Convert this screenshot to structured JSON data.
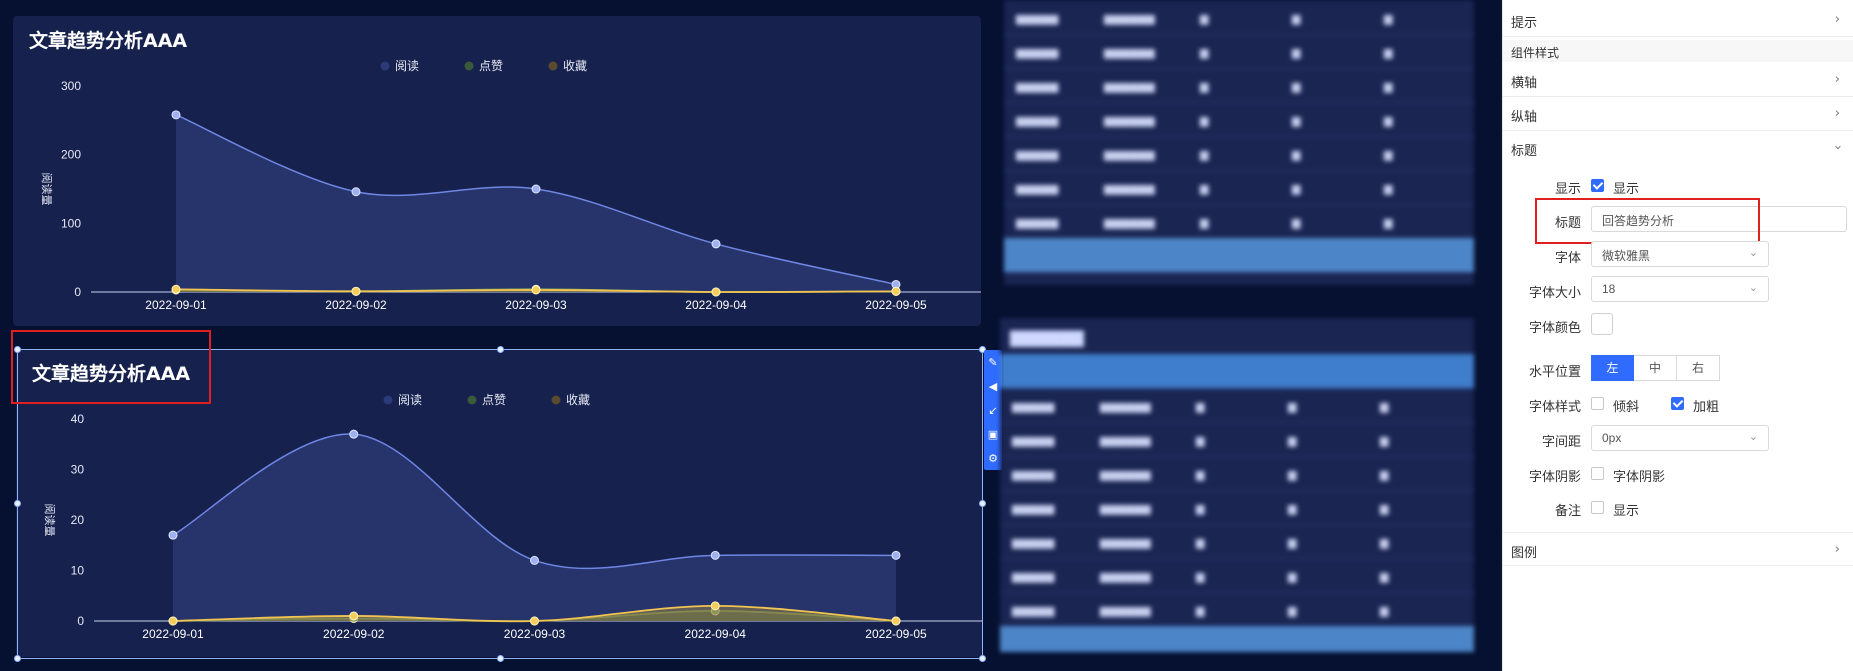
{
  "charts": [
    {
      "title": "文章趋势分析AAA",
      "legend": [
        "阅读",
        "点赞",
        "收藏"
      ],
      "ylabel": "阅读量",
      "chart_data": {
        "type": "area",
        "categories": [
          "2022-09-01",
          "2022-09-02",
          "2022-09-03",
          "2022-09-04",
          "2022-09-05"
        ],
        "ylim": [
          0,
          300
        ],
        "yticks": [
          0,
          100,
          200,
          300
        ],
        "series": [
          {
            "name": "阅读",
            "values": [
              258,
              146,
              150,
              70,
              11
            ],
            "color": "#6f86e3"
          },
          {
            "name": "点赞",
            "values": [
              3,
              1,
              4,
              0,
              1
            ],
            "color": "#7fa35a"
          },
          {
            "name": "收藏",
            "values": [
              4,
              1,
              3,
              0,
              1
            ],
            "color": "#f2c451"
          }
        ]
      }
    },
    {
      "title": "文章趋势分析AAA",
      "legend": [
        "阅读",
        "点赞",
        "收藏"
      ],
      "ylabel": "阅读量",
      "chart_data": {
        "type": "area",
        "categories": [
          "2022-09-01",
          "2022-09-02",
          "2022-09-03",
          "2022-09-04",
          "2022-09-05"
        ],
        "ylim": [
          0,
          40
        ],
        "yticks": [
          0,
          10,
          20,
          30,
          40
        ],
        "series": [
          {
            "name": "阅读",
            "values": [
              17,
              37,
              12,
              13,
              13
            ],
            "color": "#6f86e3"
          },
          {
            "name": "点赞",
            "values": [
              0,
              0.5,
              0,
              2,
              0
            ],
            "color": "#7fa35a"
          },
          {
            "name": "收藏",
            "values": [
              0,
              1,
              0,
              3,
              0
            ],
            "color": "#f2c451"
          }
        ]
      }
    }
  ],
  "colors": {
    "legend_dots": [
      "#2c3a7a",
      "#3a5a3a",
      "#5a4a30"
    ],
    "accent": "#2f6bff",
    "highlight": "#e02020"
  },
  "panel": {
    "tooltip_label": "提示",
    "section_component_style": "组件样式",
    "x_axis_label": "横轴",
    "y_axis_label": "纵轴",
    "title_group_label": "标题",
    "show_label": "显示",
    "show_checkbox_text": "显示",
    "title_field_label": "标题",
    "title_field_value": "回答趋势分析",
    "font_label": "字体",
    "font_value": "微软雅黑",
    "font_size_label": "字体大小",
    "font_size_value": "18",
    "font_color_label": "字体颜色",
    "h_position_label": "水平位置",
    "h_position_options": [
      "左",
      "中",
      "右"
    ],
    "font_style_label": "字体样式",
    "italic_text": "倾斜",
    "bold_text": "加粗",
    "letter_spacing_label": "字间距",
    "letter_spacing_value": "0px",
    "shadow_label": "字体阴影",
    "shadow_text": "字体阴影",
    "note_label": "备注",
    "note_text": "显示",
    "legend_group_label": "图例"
  }
}
